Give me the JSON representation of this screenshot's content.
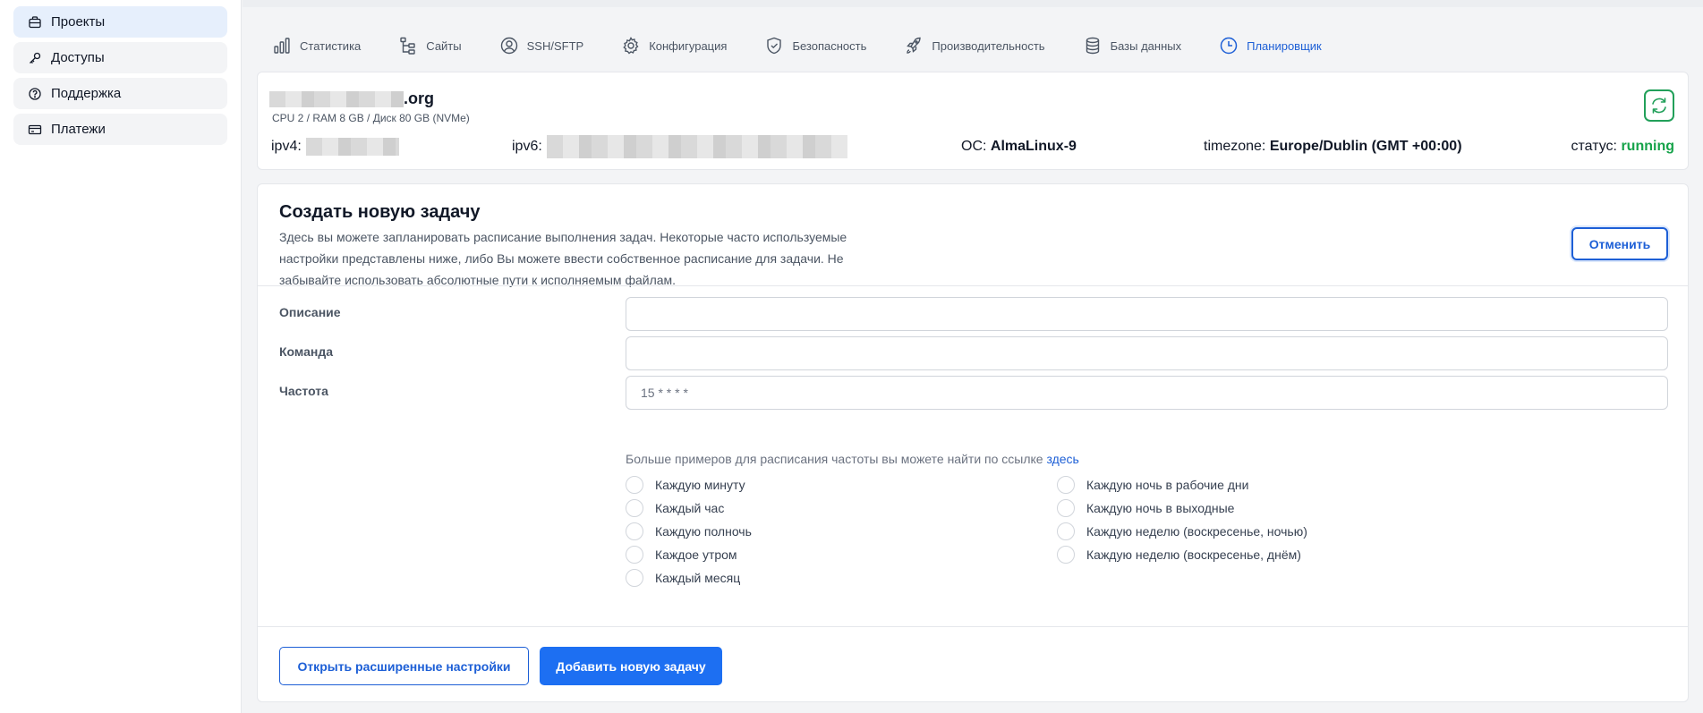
{
  "sidebar": {
    "items": [
      {
        "label": "Проекты",
        "icon": "briefcase-icon",
        "active": true
      },
      {
        "label": "Доступы",
        "icon": "key-icon",
        "active": false
      },
      {
        "label": "Поддержка",
        "icon": "help-circle-icon",
        "active": false
      },
      {
        "label": "Платежи",
        "icon": "credit-card-icon",
        "active": false
      }
    ]
  },
  "tabs": [
    {
      "label": "Статистика",
      "icon": "bar-chart-icon"
    },
    {
      "label": "Сайты",
      "icon": "sitemap-icon"
    },
    {
      "label": "SSH/SFTP",
      "icon": "user-circle-icon"
    },
    {
      "label": "Конфигурация",
      "icon": "gear-icon"
    },
    {
      "label": "Безопасность",
      "icon": "shield-check-icon"
    },
    {
      "label": "Производительность",
      "icon": "rocket-icon"
    },
    {
      "label": "Базы данных",
      "icon": "database-icon"
    },
    {
      "label": "Планировщик",
      "icon": "clock-icon",
      "active": true
    }
  ],
  "server": {
    "name_suffix": ".org",
    "specs": "CPU 2 / RAM 8 GB / Диск 80 GB (NVMe)",
    "ipv4_label": "ipv4:",
    "ipv6_label": "ipv6:",
    "os_label": "ОС:",
    "os_value": "AlmaLinux-9",
    "timezone_label": "timezone:",
    "timezone_value": "Europe/Dublin (GMT +00:00)",
    "status_label": "статус:",
    "status_value": "running"
  },
  "task": {
    "title": "Создать новую задачу",
    "description": "Здесь вы можете запланировать расписание выполнения задач. Некоторые часто используемые настройки представлены ниже, либо Вы можете ввести собственное расписание для задачи. Не забывайте использовать абсолютные пути к исполняемым файлам.",
    "cancel_label": "Отменить",
    "fields": {
      "description_label": "Описание",
      "description_value": "",
      "command_label": "Команда",
      "command_value": "",
      "frequency_label": "Частота",
      "frequency_placeholder": "15 * * * *"
    },
    "hint_text": "Больше примеров для расписания частоты вы можете найти по ссылке ",
    "hint_link": "здесь",
    "presets_left": [
      "Каждую минуту",
      "Каждый час",
      "Каждую полночь",
      "Каждое утром",
      "Каждый месяц"
    ],
    "presets_right": [
      "Каждую ночь в рабочие дни",
      "Каждую ночь в выходные",
      "Каждую неделю (воскресенье, ночью)",
      "Каждую неделю (воскресенье, днём)"
    ],
    "advanced_label": "Открыть расширенные настройки",
    "add_label": "Добавить новую задачу"
  },
  "colors": {
    "accent": "#1d6ff2",
    "status_running": "#16a34a",
    "refresh": "#22a05a"
  }
}
